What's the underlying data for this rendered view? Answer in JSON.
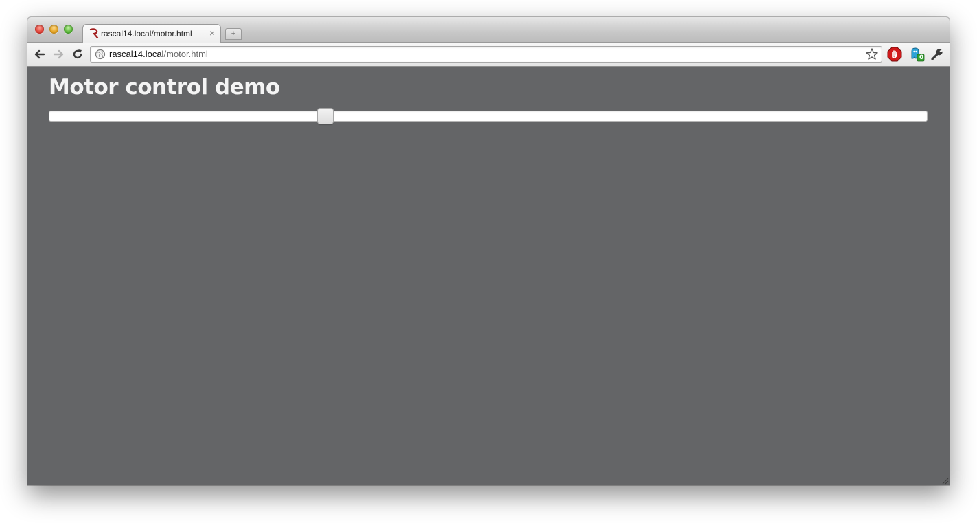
{
  "browser": {
    "tab": {
      "title": "rascal14.local/motor.html",
      "close_glyph": "×",
      "favicon": "rascal-logo-icon"
    },
    "new_tab_glyph": "+",
    "address_bar": {
      "host": "rascal14.local",
      "path": "/motor.html"
    },
    "extensions": {
      "ghost_badge": "0"
    }
  },
  "page": {
    "title": "Motor control demo",
    "slider": {
      "value_fraction": 0.315
    }
  },
  "colors": {
    "page_background": "#646567",
    "title_text": "#f4f4f4"
  }
}
